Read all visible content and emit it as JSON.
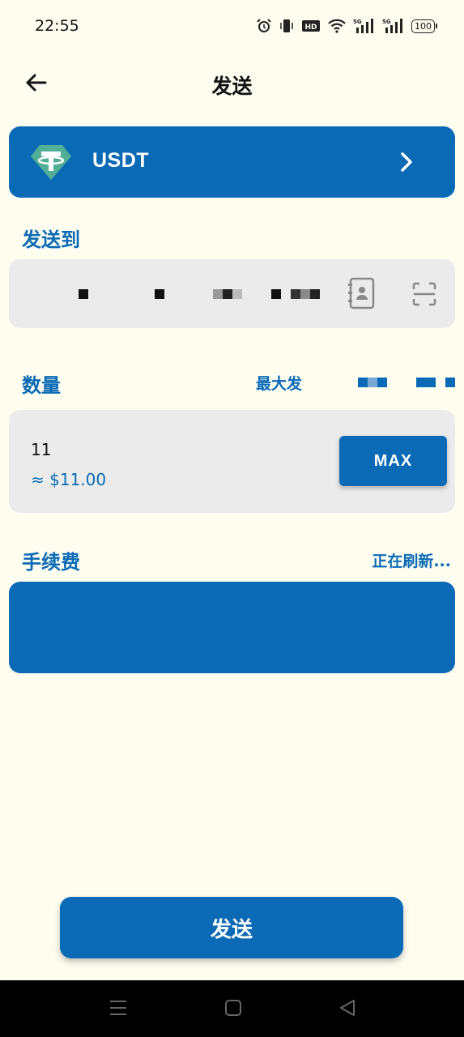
{
  "status_bar": {
    "time": "22:55",
    "battery": "100",
    "network_labels": [
      "5G",
      "5G"
    ]
  },
  "header": {
    "title": "发送",
    "back_icon": "arrow-left-icon"
  },
  "asset": {
    "name": "USDT",
    "logo_icon": "tether-icon",
    "chevron_icon": "chevron-right-icon"
  },
  "recipient": {
    "label": "发送到",
    "address_masked": true,
    "contacts_icon": "address-book-icon",
    "scan_icon": "scan-icon"
  },
  "amount": {
    "label": "数量",
    "max_hint": "最大发",
    "value": "11",
    "fiat_value": "≈ $11.00",
    "max_label": "MAX"
  },
  "fee": {
    "label": "手续费",
    "status": "正在刷新..."
  },
  "send_button": {
    "label": "发送"
  },
  "colors": {
    "primary": "#0b6ab5",
    "background": "#fdfdf0",
    "input_bg": "#ebebeb"
  }
}
